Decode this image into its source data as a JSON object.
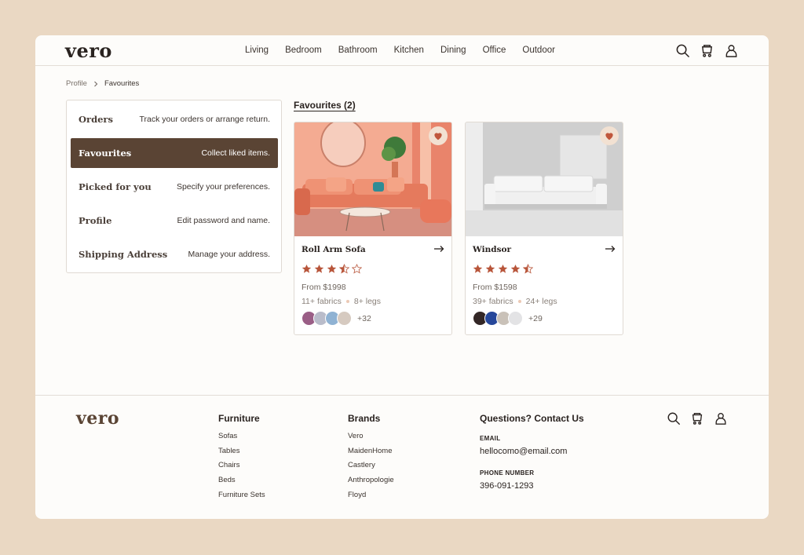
{
  "brand": {
    "logo": "vero"
  },
  "nav": {
    "items": [
      "Living",
      "Bedroom",
      "Bathroom",
      "Kitchen",
      "Dining",
      "Office",
      "Outdoor"
    ]
  },
  "breadcrumb": {
    "items": [
      "Profile",
      "Favourites"
    ]
  },
  "sidebar": {
    "items": [
      {
        "title": "Orders",
        "desc": "Track your orders or arrange return.",
        "active": false
      },
      {
        "title": "Favourites",
        "desc": "Collect liked items.",
        "active": true
      },
      {
        "title": "Picked for you",
        "desc": "Specify your preferences.",
        "active": false
      },
      {
        "title": "Profile",
        "desc": "Edit password and name.",
        "active": false
      },
      {
        "title": "Shipping Address",
        "desc": "Manage your address.",
        "active": false
      }
    ]
  },
  "favourites": {
    "title": "Favourites (2)",
    "products": [
      {
        "name": "Roll Arm Sofa",
        "rating": 3.5,
        "price": "From $1998",
        "fabrics": "11+ fabrics",
        "legs": "8+ legs",
        "swatch_colors": [
          "#9a5e86",
          "#b9bcca",
          "#8fb2d3",
          "#d6cac0"
        ],
        "more": "+32"
      },
      {
        "name": "Windsor",
        "rating": 4.5,
        "price": "From $1598",
        "fabrics": "39+ fabrics",
        "legs": "24+ legs",
        "swatch_colors": [
          "#332726",
          "#26479a",
          "#c9c1b8",
          "#e3e3e5"
        ],
        "more": "+29"
      }
    ]
  },
  "footer": {
    "logo": "vero",
    "furniture": {
      "heading": "Furniture",
      "items": [
        "Sofas",
        "Tables",
        "Chairs",
        "Beds",
        "Furniture Sets"
      ]
    },
    "brands": {
      "heading": "Brands",
      "items": [
        "Vero",
        "MaidenHome",
        "Castlery",
        "Anthropologie",
        "Floyd"
      ]
    },
    "contact": {
      "heading": "Questions? Contact Us",
      "email_label": "EMAIL",
      "email": "hellocomo@email.com",
      "phone_label": "PHONE NUMBER",
      "phone": "396-091-1293"
    }
  },
  "colors": {
    "accent": "#5a4434",
    "star": "#b8553a",
    "heart": "#c0573c"
  },
  "icons": [
    "search-icon",
    "cart-icon",
    "user-icon",
    "heart-icon",
    "arrow-right-icon",
    "chevron-right-icon",
    "star-icon"
  ]
}
